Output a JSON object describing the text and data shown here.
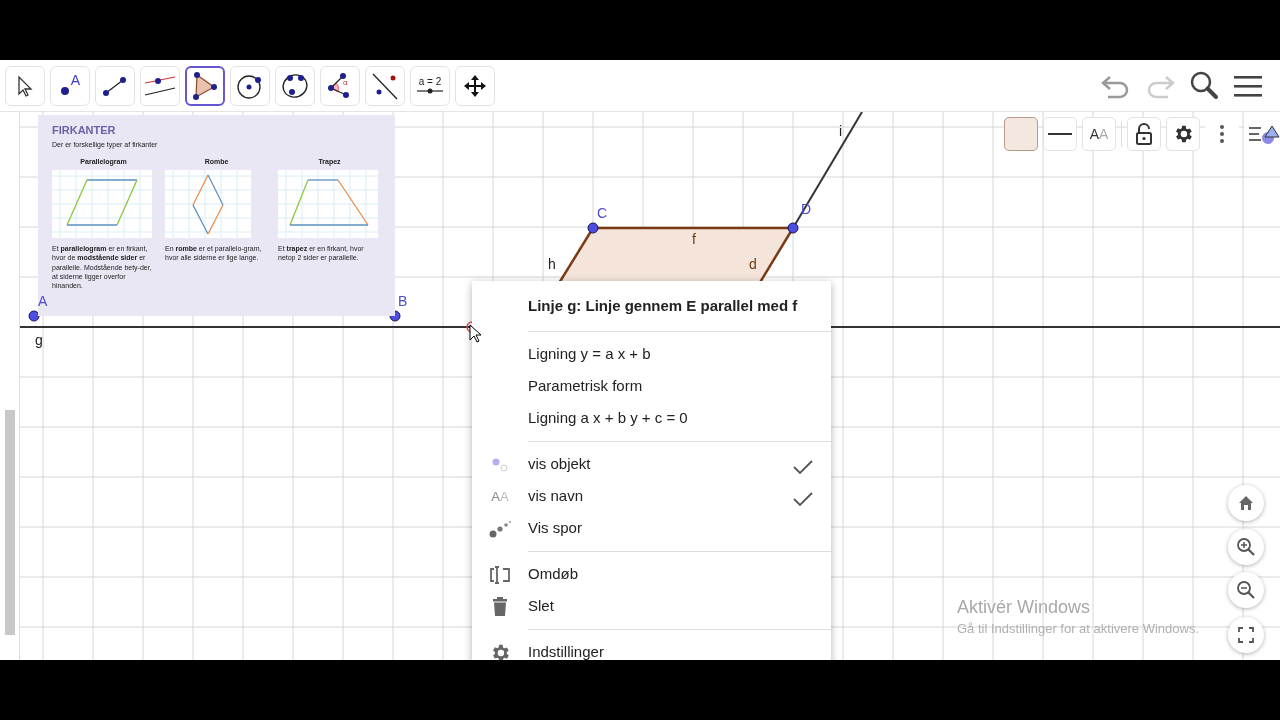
{
  "toolbar": {
    "tools": [
      {
        "kind": "move",
        "selected": false
      },
      {
        "kind": "point",
        "selected": false,
        "label": "A"
      },
      {
        "kind": "segment",
        "selected": false
      },
      {
        "kind": "parallel",
        "selected": false
      },
      {
        "kind": "polygon",
        "selected": true
      },
      {
        "kind": "circle",
        "selected": false
      },
      {
        "kind": "conic",
        "selected": false
      },
      {
        "kind": "angle",
        "selected": false,
        "label": "α"
      },
      {
        "kind": "reflect",
        "selected": false
      },
      {
        "kind": "slider",
        "selected": false,
        "label": "a = 2"
      },
      {
        "kind": "pan",
        "selected": false
      }
    ]
  },
  "style_bar": {
    "text_icon": "AA"
  },
  "image_card": {
    "title": "FIRKANTER",
    "subtitle": "Der er forskellige typer af firkanter",
    "columns": [
      {
        "heading": "Parallelogram",
        "text": "Et **parallelogram** er en firkant, hvor de **modstående sider** er parallelle. Modstående bety-der, at siderne ligger overfor hinanden."
      },
      {
        "heading": "Rombe",
        "text": "En **rombe** er et parallelo-gram, hvor alle siderne er lige lange."
      },
      {
        "heading": "Trapez",
        "text": "Et **trapez** er en firkant, hvor netop 2 sider er parallelle."
      }
    ]
  },
  "canvas": {
    "points": [
      {
        "label": "A"
      },
      {
        "label": "B"
      },
      {
        "label": "C"
      },
      {
        "label": "D"
      }
    ],
    "line_labels": [
      {
        "label": "g"
      },
      {
        "label": "h"
      },
      {
        "label": "f"
      },
      {
        "label": "d"
      },
      {
        "label": "i"
      }
    ]
  },
  "context_menu": {
    "title": "Linje g: Linje gennem E parallel med f",
    "sections": [
      {
        "items": [
          {
            "kind": "option",
            "label": "Ligning y = a x + b"
          },
          {
            "kind": "option",
            "label": "Parametrisk form"
          },
          {
            "kind": "option",
            "label": "Ligning a x + b y + c = 0"
          }
        ]
      },
      {
        "items": [
          {
            "kind": "toggle",
            "label": "vis objekt",
            "checked": true
          },
          {
            "kind": "toggle",
            "icon_text": "AA",
            "label": "vis navn",
            "checked": true
          },
          {
            "kind": "toggle",
            "label": "Vis spor",
            "checked": false
          }
        ]
      },
      {
        "items": [
          {
            "kind": "action",
            "label": "Omdøb"
          },
          {
            "kind": "action",
            "label": "Slet"
          }
        ]
      },
      {
        "items": [
          {
            "kind": "action",
            "label": "Indstillinger"
          }
        ]
      }
    ]
  },
  "windows_notice": {
    "title": "Aktivér Windows",
    "text": "Gå til Indstillinger for at aktivere Windows."
  }
}
